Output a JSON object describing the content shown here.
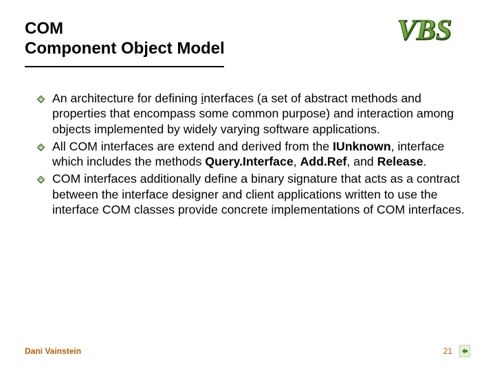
{
  "title": {
    "line1": "COM",
    "line2": "Component Object Model"
  },
  "logo_text": "VBS",
  "bullets": [
    {
      "segments": [
        {
          "t": "An architecture for defining ",
          "b": false
        },
        {
          "t": "i",
          "b": false,
          "u": true
        },
        {
          "t": "nterfaces (a set of abstract methods and properties that encompass some common purpose) and interaction among objects implemented by widely varying software applications.",
          "b": false
        }
      ]
    },
    {
      "segments": [
        {
          "t": "All COM interfaces are extend and derived from the ",
          "b": false
        },
        {
          "t": "IUnknown",
          "b": true
        },
        {
          "t": ", interface which includes the methods ",
          "b": false
        },
        {
          "t": "Query.Interface",
          "b": true
        },
        {
          "t": ", ",
          "b": false
        },
        {
          "t": "Add.Ref",
          "b": true
        },
        {
          "t": ", and ",
          "b": false
        },
        {
          "t": "Release",
          "b": true
        },
        {
          "t": ".",
          "b": false
        }
      ]
    },
    {
      "segments": [
        {
          "t": "COM interfaces additionally define a binary signature that acts as a contract between the interface designer and client applications written to use the interface COM classes provide concrete implementations of COM interfaces.",
          "b": false
        }
      ]
    }
  ],
  "footer": {
    "author": "Dani Vainstein",
    "page": "21"
  }
}
